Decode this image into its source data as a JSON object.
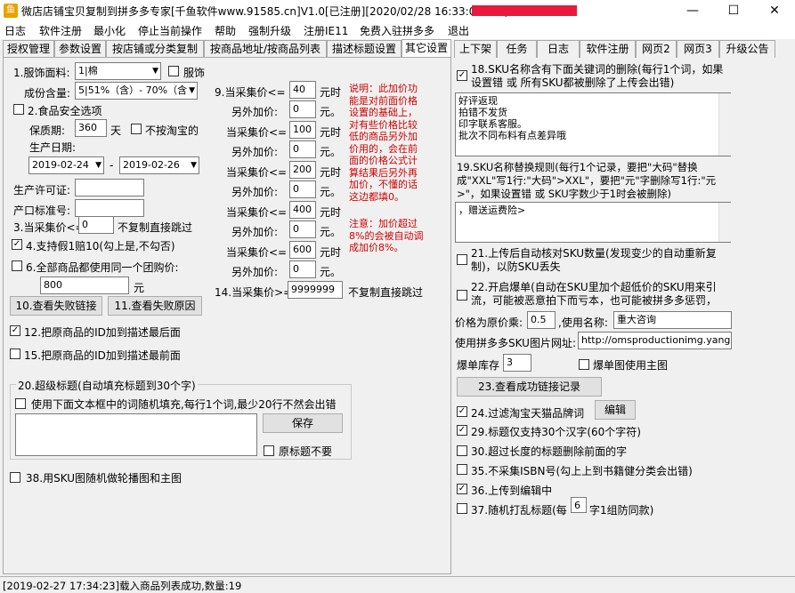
{
  "window": {
    "title": "微店店铺宝贝复制到拼多多专家[千鱼软件www.91585.cn]V1.0[已注册][2020/02/28 16:33:00到期]-",
    "min": "—",
    "max": "☐",
    "close": "✕"
  },
  "menu": [
    "日志",
    "软件注册",
    "最小化",
    "停止当前操作",
    "帮助",
    "强制升级",
    "注册IE11",
    "免费入驻拼多多",
    "退出"
  ],
  "left_tabs": [
    "授权管理",
    "参数设置",
    "按店铺或分类复制",
    "按商品地址/按商品列表",
    "描述标题设置",
    "其它设置"
  ],
  "right_tabs": [
    "上下架",
    "任务",
    "日志",
    "软件注册",
    "网页2",
    "网页3",
    "升级公告"
  ],
  "left": {
    "fabric_label": "1.服饰面料:",
    "fabric_value": "1|棉",
    "apparel_label": "服饰",
    "ingredient_label": "成份含量:",
    "ingredient_value": "5|51%（含）- 70%（含",
    "food_label": "2.食品安全选项",
    "shelf_label": "保质期:",
    "shelf_value": "360",
    "shelf_unit": "天",
    "not_taobao_label": "不按淘宝的",
    "prod_date_label": "生产日期:",
    "date_from": "2019-02-24",
    "date_sep": "-",
    "date_to": "2019-02-26",
    "license_label": "生产许可证:",
    "standard_label": "产口标准号:",
    "collect_price_label": "3.当采集价<=",
    "collect_price_value": "0",
    "skip_label": "不复制直接跳过",
    "fake_label": "4.支持假1赔10(勾上是,不勾否)",
    "group_label": "6.全部商品都使用同一个团购价:",
    "group_value": "800",
    "group_unit": "元",
    "btn_fail_link": "10.查看失败链接",
    "btn_fail_reason": "11.查看失败原因",
    "id_last_label": "12.把原商品的ID加到描述最后面",
    "id_first_label": "15.把原商品的ID加到描述最前面",
    "super_title_legend": "20.超级标题(自动填充标题到30个字)",
    "super_title_cb": "使用下面文本框中的词随机填充,每行1个词,最少20行不然会出错",
    "save_btn": "保存",
    "no_orig_title": "原标题不要",
    "sku_main_label": "38.用SKU图随机做轮播图和主图"
  },
  "price": {
    "rows": [
      {
        "label": "9.当采集价<=",
        "value": "40",
        "unit": "元时",
        "add_label": "另外加价:",
        "add_value": "0",
        "add_unit": "元。"
      },
      {
        "label": "当采集价<=",
        "value": "100",
        "unit": "元时",
        "add_label": "另外加价:",
        "add_value": "0",
        "add_unit": "元。"
      },
      {
        "label": "当采集价<=",
        "value": "200",
        "unit": "元时",
        "add_label": "另外加价:",
        "add_value": "0",
        "add_unit": "元。"
      },
      {
        "label": "当采集价<=",
        "value": "400",
        "unit": "元时",
        "add_label": "另外加价:",
        "add_value": "0",
        "add_unit": "元。"
      },
      {
        "label": "当采集价<=",
        "value": "600",
        "unit": "元时",
        "add_label": "另外加价:",
        "add_value": "0",
        "add_unit": "元。"
      }
    ],
    "explain": [
      "说明：此加价功",
      "能是对前面价格",
      "设置的基础上，",
      "对有些价格比较",
      "低的商品另外加",
      "价用的，会在前",
      "面的价格公式计",
      "算结果后另外再",
      "加价，不懂的话",
      "这边都填0。"
    ],
    "note": [
      "注意：加价超过",
      "8%的会被自动调",
      "成加价8%。"
    ],
    "row14_label": "14.当采集价>=",
    "row14_value": "9999999",
    "row14_skip": "不复制直接跳过"
  },
  "right": {
    "r18_label": [
      "18.SKU名称含有下面关键词的删除(每行1个词，如果",
      "设置错 或 所有SKU都被删除了上传会出错)"
    ],
    "r18_text": "好评返现\n拍错不发货\n印字联系客服。\n批次不同布料有点差异哦",
    "r19_label": [
      "19.SKU名称替换规则(每行1个记录，要把\"大码\"替换",
      "成\"XXL\"写1行:\"大码\">XXL\"，要把\"元\"字删除写1行:\"元",
      ">\"，如果设置错 或 SKU字数少于1时会被删除)"
    ],
    "r19_text": "，赠送运费险>",
    "r21_label": [
      "21.上传后自动核对SKU数量(发现变少的自动重新复",
      "制)，以防SKU丢失"
    ],
    "r22_label": [
      "22.开启爆单(自动在SKU里加个超低价的SKU用来引",
      "流，可能被恶意拍下而亏本，也可能被拼多多惩罚，"
    ],
    "multiplier_label": "价格为原价乘:",
    "multiplier_value": "0.5",
    "use_name_label": ",使用名称:",
    "use_name_value": "重大咨询",
    "sku_img_label": "使用拼多多SKU图片网址:",
    "sku_img_value": "http://omsproductionimg.yang",
    "stock_label": "爆单库存",
    "stock_value": "3",
    "main_img_label": "爆单图使用主图",
    "btn_success": "23.查看成功链接记录",
    "r24_label": "24.过滤淘宝天猫品牌词",
    "edit_btn": "编辑",
    "r29_label": "29.标题仅支持30个汉字(60个字符)",
    "r30_label": "30.超过长度的标题删除前面的字",
    "r35_label": "35.不采集ISBN号(勾上上到书籍健分类会出错)",
    "r36_label": "36.上传到编辑中",
    "r37_label_a": "37.随机打乱标题(每",
    "r37_value": "6",
    "r37_label_b": "字1组防同款)"
  },
  "status": "[2019-02-27 17:34:23]载入商品列表成功,数量:19",
  "colors": {
    "redact": "#e8193c",
    "note_red": "#d00000",
    "icon": "#e8a200"
  }
}
